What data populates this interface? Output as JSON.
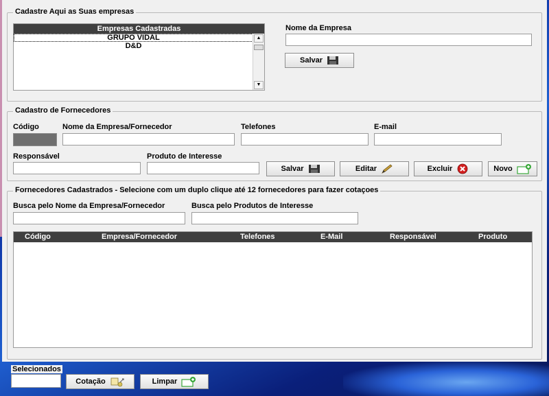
{
  "empresas": {
    "group_title": "Cadastre Aqui as Suas empresas",
    "list_header": "Empresas Cadastradas",
    "list_items": [
      "GRUPO VIDAL",
      "D&D"
    ],
    "nome_label": "Nome da Empresa",
    "nome_value": "",
    "salvar_label": "Salvar"
  },
  "fornecedores": {
    "group_title": "Cadastro de Fornecedores",
    "codigo_label": "Código",
    "nome_label": "Nome da Empresa/Fornecedor",
    "telefones_label": "Telefones",
    "email_label": "E-mail",
    "responsavel_label": "Responsável",
    "produto_label": "Produto de Interesse",
    "salvar_label": "Salvar",
    "editar_label": "Editar",
    "excluir_label": "Excluir",
    "novo_label": "Novo"
  },
  "cadastrados": {
    "group_title": "Fornecedores Cadastrados - Selecione com um duplo clique até 12 fornecedores para fazer cotaçoes",
    "busca_nome_label": "Busca pelo Nome da Empresa/Fornecedor",
    "busca_produto_label": "Busca pelo Produtos de Interesse",
    "columns": [
      "Código",
      "Empresa/Fornecedor",
      "Telefones",
      "E-Mail",
      "Responsável",
      "Produto"
    ]
  },
  "footer": {
    "selecionados_label": "Selecionados",
    "cotacao_label": "Cotação",
    "limpar_label": "Limpar"
  },
  "colors": {
    "form_bg": "#f0f0f0",
    "header_bg": "#3f3f3f",
    "excluir_icon": "#d42020",
    "novo_icon": "#3aa83a"
  },
  "icons": {
    "salvar": "floppy-disk-icon",
    "editar": "pencil-icon",
    "excluir": "delete-x-icon",
    "novo": "new-card-icon",
    "cotacao": "cotacao-icon"
  }
}
